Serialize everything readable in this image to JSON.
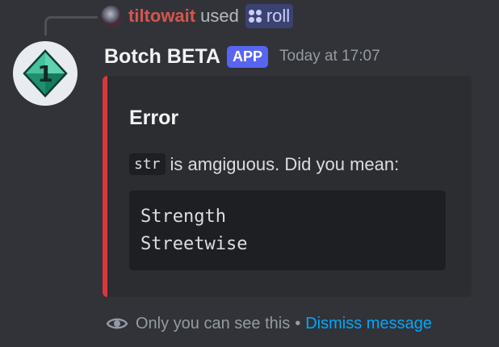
{
  "reply": {
    "username": "tiltowait",
    "used_text": "used",
    "command_name": "roll",
    "username_color": "#d4564f"
  },
  "message": {
    "author": "Botch BETA",
    "badge": "APP",
    "timestamp": "Today at 17:07",
    "avatar_icon": "d10-die-icon",
    "avatar_number": "1"
  },
  "embed": {
    "accent_color": "#da373c",
    "title": "Error",
    "inline_code": "str",
    "description": "is amgiguous. Did you mean:",
    "code_lines": [
      "Strength",
      "Streetwise"
    ]
  },
  "ephemeral": {
    "icon": "eye-icon",
    "notice": "Only you can see this",
    "separator": "•",
    "dismiss": "Dismiss message"
  }
}
